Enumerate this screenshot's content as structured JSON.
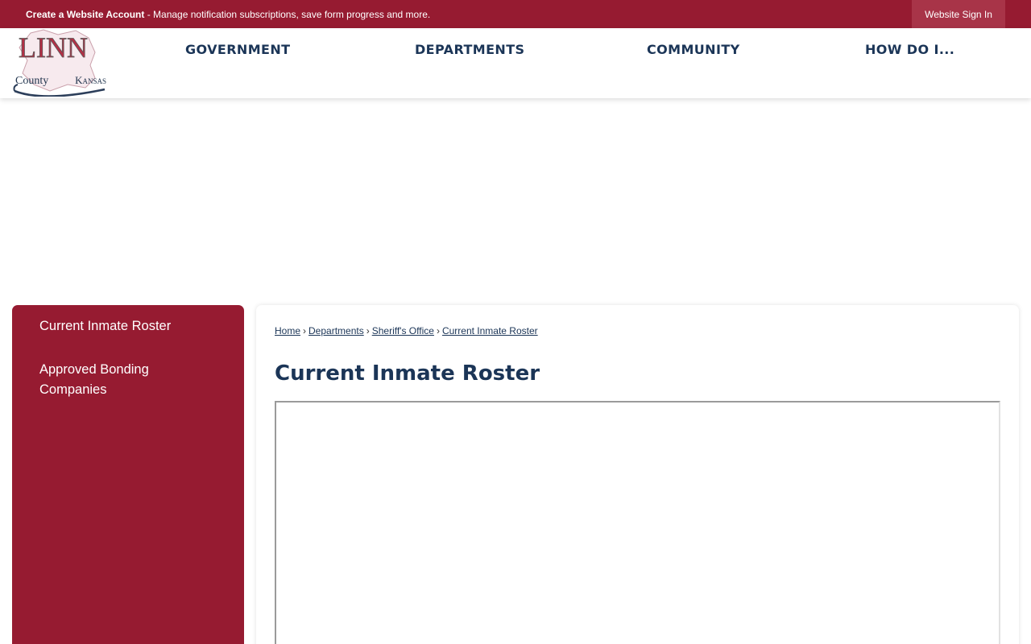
{
  "topbar": {
    "create_account": "Create a Website Account",
    "message": " - Manage notification subscriptions, save form progress and more.",
    "sign_in": "Website Sign In"
  },
  "logo": {
    "line1": "LINN",
    "county": "County",
    "state": "Kansas"
  },
  "nav": {
    "items": [
      {
        "label": "GOVERNMENT"
      },
      {
        "label": "DEPARTMENTS"
      },
      {
        "label": "COMMUNITY"
      },
      {
        "label": "HOW DO I..."
      }
    ]
  },
  "sidebar": {
    "items": [
      {
        "label": "Current Inmate Roster"
      },
      {
        "label": "Approved Bonding Companies"
      }
    ]
  },
  "breadcrumb": {
    "items": [
      {
        "label": "Home"
      },
      {
        "label": "Departments"
      },
      {
        "label": "Sheriff's Office"
      },
      {
        "label": "Current Inmate Roster"
      }
    ],
    "separator": "›"
  },
  "main": {
    "title": "Current Inmate Roster"
  },
  "colors": {
    "brand": "#961b31",
    "nav_text": "#1b3557"
  }
}
